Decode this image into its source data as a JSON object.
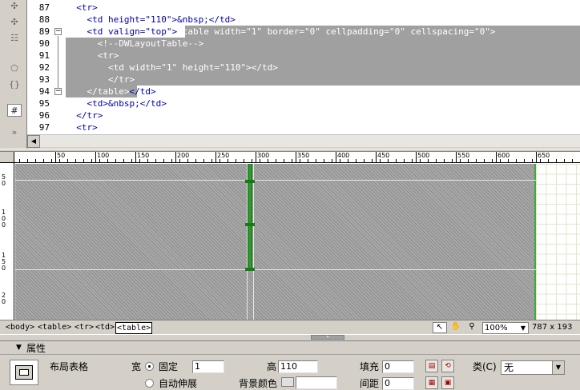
{
  "code": {
    "lines": [
      {
        "num": "87",
        "text": "  <tr>"
      },
      {
        "num": "88",
        "text": "    <td height=\"110\">&nbsp;</td>"
      },
      {
        "num": "89",
        "pre": "    <td valign=\"top\">",
        "sel": "<table width=\"1\" border=\"0\" cellpadding=\"0\" cellspacing=\"0\">"
      },
      {
        "num": "90",
        "text": "      <!--DWLayoutTable-->"
      },
      {
        "num": "91",
        "text": "      <tr>"
      },
      {
        "num": "92",
        "text": "        <td width=\"1\" height=\"110\"></td>"
      },
      {
        "num": "93",
        "text": "        </tr>"
      },
      {
        "num": "94",
        "sel": "    </table>",
        "post": "</td>"
      },
      {
        "num": "95",
        "text": "    <td>&nbsp;</td>"
      },
      {
        "num": "96",
        "text": "  </tr>"
      },
      {
        "num": "97",
        "text": "  <tr>"
      }
    ],
    "toolbar_icons": [
      "wrap-icon",
      "select-parent-icon",
      "balance-braces-icon",
      "line-numbers-icon",
      "highlight-invalid-icon",
      "syntax-icon",
      "comment-icon",
      "collapse-icon"
    ]
  },
  "ruler": {
    "h_ticks": [
      "50",
      "100",
      "150",
      "200",
      "250",
      "300",
      "350",
      "400",
      "450",
      "500",
      "550",
      "600",
      "650"
    ],
    "v_ticks": [
      "5\n0",
      "1\n0\n0",
      "1\n5\n0",
      "2\n0"
    ]
  },
  "status": {
    "tags": [
      "<body>",
      "<table>",
      "<tr>",
      "<td>",
      "<table>"
    ],
    "zoom": "100%",
    "dimensions": "787 x 193"
  },
  "inspector": {
    "title": "属性",
    "element_name": "布局表格",
    "width_label": "宽",
    "fixed_label": "固定",
    "width_value": "1",
    "auto_label": "自动伸展",
    "height_label": "高",
    "height_value": "110",
    "bgcolor_label": "背景颜色",
    "padding_label": "填充",
    "padding_value": "0",
    "spacing_label": "间距",
    "spacing_value": "0",
    "class_label": "类(C)",
    "class_value": "无"
  },
  "colors": {
    "selection": "#a0a0a0",
    "layout_table_border": "#3cac3c",
    "panel_bg": "#d4d0c8"
  }
}
